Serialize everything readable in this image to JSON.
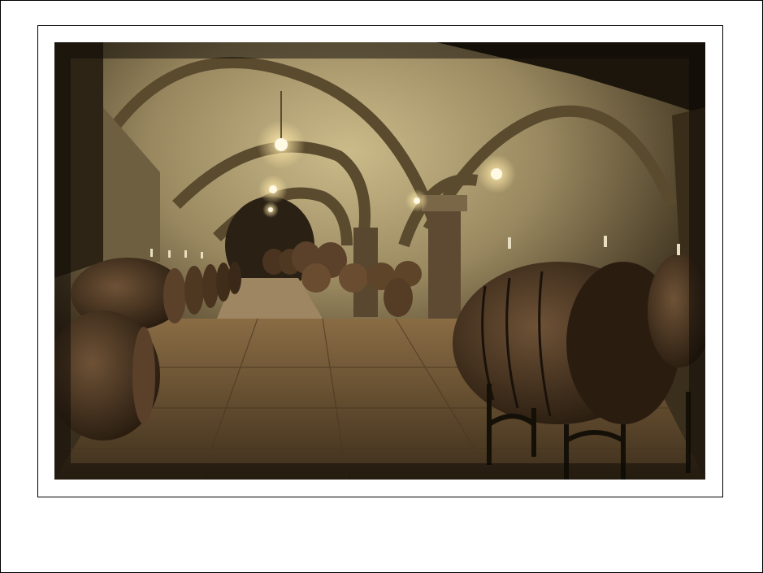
{
  "image": {
    "subject": "",
    "palette": {
      "border": "#000000",
      "mat": "#ffffff",
      "shadow": "#120d07",
      "stone": "#8a7a55",
      "vault": "#b7a677",
      "wood": "#4a3420",
      "floor": "#6b5434",
      "light": "#fff6d8"
    }
  }
}
